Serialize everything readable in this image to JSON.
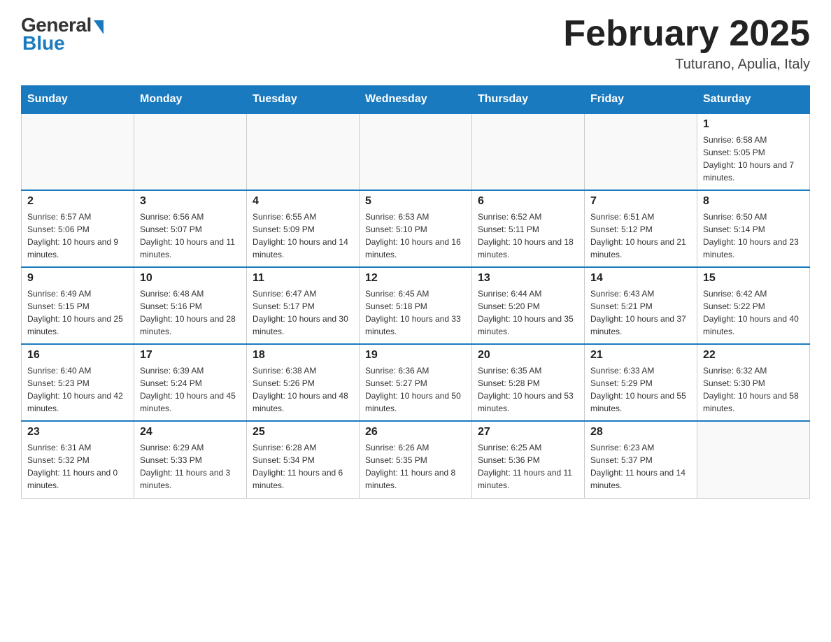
{
  "header": {
    "logo_general": "General",
    "logo_blue": "Blue",
    "month_title": "February 2025",
    "location": "Tuturano, Apulia, Italy"
  },
  "weekdays": [
    "Sunday",
    "Monday",
    "Tuesday",
    "Wednesday",
    "Thursday",
    "Friday",
    "Saturday"
  ],
  "weeks": [
    [
      {
        "day": "",
        "sunrise": "",
        "sunset": "",
        "daylight": ""
      },
      {
        "day": "",
        "sunrise": "",
        "sunset": "",
        "daylight": ""
      },
      {
        "day": "",
        "sunrise": "",
        "sunset": "",
        "daylight": ""
      },
      {
        "day": "",
        "sunrise": "",
        "sunset": "",
        "daylight": ""
      },
      {
        "day": "",
        "sunrise": "",
        "sunset": "",
        "daylight": ""
      },
      {
        "day": "",
        "sunrise": "",
        "sunset": "",
        "daylight": ""
      },
      {
        "day": "1",
        "sunrise": "Sunrise: 6:58 AM",
        "sunset": "Sunset: 5:05 PM",
        "daylight": "Daylight: 10 hours and 7 minutes."
      }
    ],
    [
      {
        "day": "2",
        "sunrise": "Sunrise: 6:57 AM",
        "sunset": "Sunset: 5:06 PM",
        "daylight": "Daylight: 10 hours and 9 minutes."
      },
      {
        "day": "3",
        "sunrise": "Sunrise: 6:56 AM",
        "sunset": "Sunset: 5:07 PM",
        "daylight": "Daylight: 10 hours and 11 minutes."
      },
      {
        "day": "4",
        "sunrise": "Sunrise: 6:55 AM",
        "sunset": "Sunset: 5:09 PM",
        "daylight": "Daylight: 10 hours and 14 minutes."
      },
      {
        "day": "5",
        "sunrise": "Sunrise: 6:53 AM",
        "sunset": "Sunset: 5:10 PM",
        "daylight": "Daylight: 10 hours and 16 minutes."
      },
      {
        "day": "6",
        "sunrise": "Sunrise: 6:52 AM",
        "sunset": "Sunset: 5:11 PM",
        "daylight": "Daylight: 10 hours and 18 minutes."
      },
      {
        "day": "7",
        "sunrise": "Sunrise: 6:51 AM",
        "sunset": "Sunset: 5:12 PM",
        "daylight": "Daylight: 10 hours and 21 minutes."
      },
      {
        "day": "8",
        "sunrise": "Sunrise: 6:50 AM",
        "sunset": "Sunset: 5:14 PM",
        "daylight": "Daylight: 10 hours and 23 minutes."
      }
    ],
    [
      {
        "day": "9",
        "sunrise": "Sunrise: 6:49 AM",
        "sunset": "Sunset: 5:15 PM",
        "daylight": "Daylight: 10 hours and 25 minutes."
      },
      {
        "day": "10",
        "sunrise": "Sunrise: 6:48 AM",
        "sunset": "Sunset: 5:16 PM",
        "daylight": "Daylight: 10 hours and 28 minutes."
      },
      {
        "day": "11",
        "sunrise": "Sunrise: 6:47 AM",
        "sunset": "Sunset: 5:17 PM",
        "daylight": "Daylight: 10 hours and 30 minutes."
      },
      {
        "day": "12",
        "sunrise": "Sunrise: 6:45 AM",
        "sunset": "Sunset: 5:18 PM",
        "daylight": "Daylight: 10 hours and 33 minutes."
      },
      {
        "day": "13",
        "sunrise": "Sunrise: 6:44 AM",
        "sunset": "Sunset: 5:20 PM",
        "daylight": "Daylight: 10 hours and 35 minutes."
      },
      {
        "day": "14",
        "sunrise": "Sunrise: 6:43 AM",
        "sunset": "Sunset: 5:21 PM",
        "daylight": "Daylight: 10 hours and 37 minutes."
      },
      {
        "day": "15",
        "sunrise": "Sunrise: 6:42 AM",
        "sunset": "Sunset: 5:22 PM",
        "daylight": "Daylight: 10 hours and 40 minutes."
      }
    ],
    [
      {
        "day": "16",
        "sunrise": "Sunrise: 6:40 AM",
        "sunset": "Sunset: 5:23 PM",
        "daylight": "Daylight: 10 hours and 42 minutes."
      },
      {
        "day": "17",
        "sunrise": "Sunrise: 6:39 AM",
        "sunset": "Sunset: 5:24 PM",
        "daylight": "Daylight: 10 hours and 45 minutes."
      },
      {
        "day": "18",
        "sunrise": "Sunrise: 6:38 AM",
        "sunset": "Sunset: 5:26 PM",
        "daylight": "Daylight: 10 hours and 48 minutes."
      },
      {
        "day": "19",
        "sunrise": "Sunrise: 6:36 AM",
        "sunset": "Sunset: 5:27 PM",
        "daylight": "Daylight: 10 hours and 50 minutes."
      },
      {
        "day": "20",
        "sunrise": "Sunrise: 6:35 AM",
        "sunset": "Sunset: 5:28 PM",
        "daylight": "Daylight: 10 hours and 53 minutes."
      },
      {
        "day": "21",
        "sunrise": "Sunrise: 6:33 AM",
        "sunset": "Sunset: 5:29 PM",
        "daylight": "Daylight: 10 hours and 55 minutes."
      },
      {
        "day": "22",
        "sunrise": "Sunrise: 6:32 AM",
        "sunset": "Sunset: 5:30 PM",
        "daylight": "Daylight: 10 hours and 58 minutes."
      }
    ],
    [
      {
        "day": "23",
        "sunrise": "Sunrise: 6:31 AM",
        "sunset": "Sunset: 5:32 PM",
        "daylight": "Daylight: 11 hours and 0 minutes."
      },
      {
        "day": "24",
        "sunrise": "Sunrise: 6:29 AM",
        "sunset": "Sunset: 5:33 PM",
        "daylight": "Daylight: 11 hours and 3 minutes."
      },
      {
        "day": "25",
        "sunrise": "Sunrise: 6:28 AM",
        "sunset": "Sunset: 5:34 PM",
        "daylight": "Daylight: 11 hours and 6 minutes."
      },
      {
        "day": "26",
        "sunrise": "Sunrise: 6:26 AM",
        "sunset": "Sunset: 5:35 PM",
        "daylight": "Daylight: 11 hours and 8 minutes."
      },
      {
        "day": "27",
        "sunrise": "Sunrise: 6:25 AM",
        "sunset": "Sunset: 5:36 PM",
        "daylight": "Daylight: 11 hours and 11 minutes."
      },
      {
        "day": "28",
        "sunrise": "Sunrise: 6:23 AM",
        "sunset": "Sunset: 5:37 PM",
        "daylight": "Daylight: 11 hours and 14 minutes."
      },
      {
        "day": "",
        "sunrise": "",
        "sunset": "",
        "daylight": ""
      }
    ]
  ]
}
